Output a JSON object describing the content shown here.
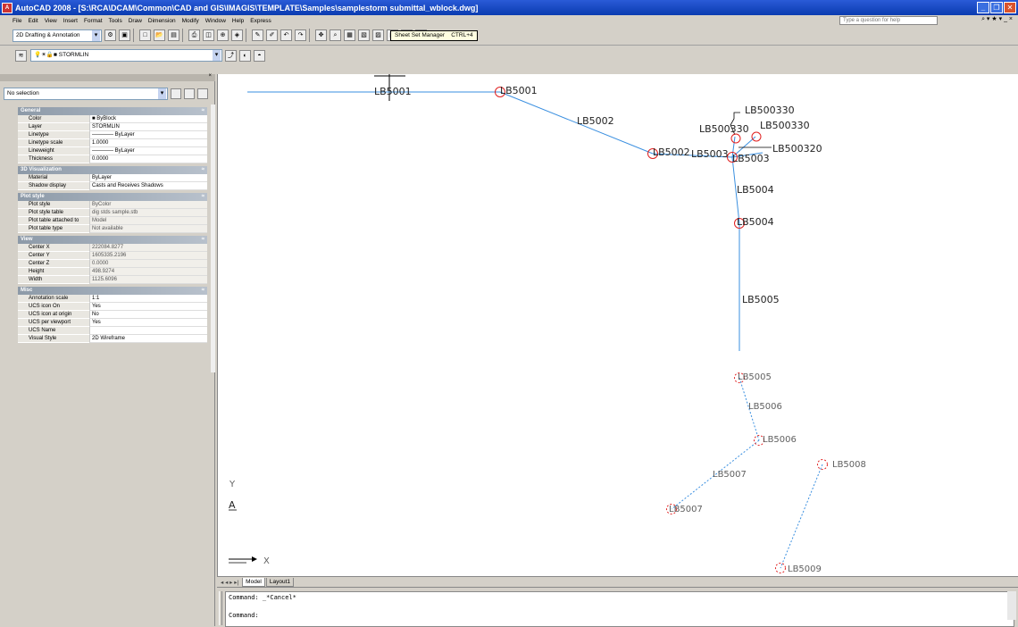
{
  "window": {
    "title": "AutoCAD 2008 - [S:\\RCA\\DCAM\\Common\\CAD and GIS\\IMAGIS\\TEMPLATE\\Samples\\samplestorm submittal_wblock.dwg]",
    "app_icon_text": "A"
  },
  "menu": {
    "items": [
      "File",
      "Edit",
      "View",
      "Insert",
      "Format",
      "Tools",
      "Draw",
      "Dimension",
      "Modify",
      "Window",
      "Help",
      "Express"
    ],
    "help_placeholder": "Type a question for help"
  },
  "toolbar": {
    "workspace": "2D Drafting & Annotation",
    "tooltip": "Sheet Set Manager    CTRL+4",
    "layer": "STORMLIN"
  },
  "palette": {
    "selection": "No selection",
    "sections": [
      {
        "name": "General",
        "rows": [
          {
            "key": "Color",
            "value": "■ ByBlock"
          },
          {
            "key": "Layer",
            "value": "STORMLIN"
          },
          {
            "key": "Linetype",
            "value": "———— ByLayer"
          },
          {
            "key": "Linetype scale",
            "value": "1.0000"
          },
          {
            "key": "Lineweight",
            "value": "———— ByLayer"
          },
          {
            "key": "Thickness",
            "value": "0.0000"
          }
        ]
      },
      {
        "name": "3D Visualization",
        "rows": [
          {
            "key": "Material",
            "value": "ByLayer"
          },
          {
            "key": "Shadow display",
            "value": "Casts and Receives Shadows"
          }
        ]
      },
      {
        "name": "Plot style",
        "rows": [
          {
            "key": "Plot style",
            "value": "ByColor"
          },
          {
            "key": "Plot style table",
            "value": "dig stds sample.stb"
          },
          {
            "key": "Plot table attached to",
            "value": "Model"
          },
          {
            "key": "Plot table type",
            "value": "Not available"
          }
        ]
      },
      {
        "name": "View",
        "rows": [
          {
            "key": "Center X",
            "value": "222084.8277"
          },
          {
            "key": "Center Y",
            "value": "1605335.2196"
          },
          {
            "key": "Center Z",
            "value": "0.0000"
          },
          {
            "key": "Height",
            "value": "498.9274"
          },
          {
            "key": "Width",
            "value": "1125.6096"
          }
        ]
      },
      {
        "name": "Misc",
        "rows": [
          {
            "key": "Annotation scale",
            "value": "1:1"
          },
          {
            "key": "UCS icon On",
            "value": "Yes"
          },
          {
            "key": "UCS icon at origin",
            "value": "No"
          },
          {
            "key": "UCS per viewport",
            "value": "Yes"
          },
          {
            "key": "UCS Name",
            "value": ""
          },
          {
            "key": "Visual Style",
            "value": "2D Wireframe"
          }
        ]
      }
    ]
  },
  "drawing": {
    "line_color": "#3a8fe0",
    "node_color": "#e02020",
    "labels": {
      "lb5001_line": "LB5001",
      "lb5001_node": "LB5001",
      "lb5002_line": "LB5002",
      "lb5002_node": "LB5002",
      "lb5003_line": "LB5003",
      "lb5003_node": "LB5003",
      "lb500330_a": "LB500330",
      "lb500330_b": "LB500330",
      "lb500320": "LB500320",
      "lb5004_line": "LB5004",
      "lb5004_node": "LB5004",
      "lb5005_line": "LB5005",
      "lb5005_node": "LB5005",
      "lb5006_line": "LB5006",
      "lb5006_node": "LB5006",
      "lb5007_line": "LB5007",
      "lb5007_node": "LB5007",
      "lb5008": "LB5008",
      "lb5009": "LB5009"
    },
    "ucs": {
      "y": "Y",
      "x": "X",
      "a": "A"
    }
  },
  "tabs": [
    "Model",
    "Layout1"
  ],
  "command": {
    "line1": "Command: _*Cancel*",
    "line2": "Command:"
  }
}
